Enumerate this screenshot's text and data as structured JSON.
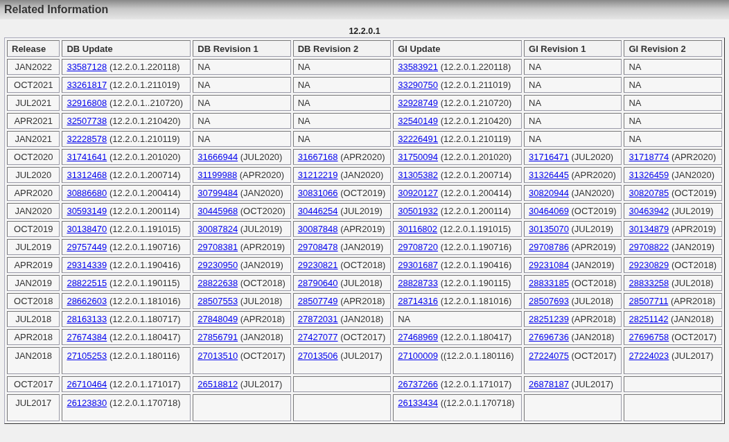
{
  "panel": {
    "title": "Related Information"
  },
  "table": {
    "caption": "12.2.0.1",
    "columns": [
      "Release",
      "DB Update",
      "DB Revision 1",
      "DB Revision 2",
      "GI Update",
      "GI Revision 1",
      "GI Revision 2"
    ],
    "rows": [
      {
        "cells": [
          {
            "kind": "text",
            "text": "JAN2022"
          },
          {
            "kind": "link",
            "link": "33587128",
            "note": "(12.2.0.1.220118)"
          },
          {
            "kind": "text",
            "text": "NA"
          },
          {
            "kind": "text",
            "text": "NA"
          },
          {
            "kind": "link",
            "link": "33583921",
            "note": "(12.2.0.1.220118)"
          },
          {
            "kind": "text",
            "text": "NA"
          },
          {
            "kind": "text",
            "text": "NA"
          }
        ]
      },
      {
        "cells": [
          {
            "kind": "text",
            "text": "OCT2021"
          },
          {
            "kind": "link",
            "link": "33261817",
            "note": "(12.2.0.1.211019)"
          },
          {
            "kind": "text",
            "text": "NA"
          },
          {
            "kind": "text",
            "text": "NA"
          },
          {
            "kind": "link",
            "link": "33290750",
            "note": "(12.2.0.1.211019)"
          },
          {
            "kind": "text",
            "text": "NA"
          },
          {
            "kind": "text",
            "text": "NA"
          }
        ]
      },
      {
        "cells": [
          {
            "kind": "text",
            "text": "JUL2021"
          },
          {
            "kind": "link",
            "link": "32916808",
            "note": "(12.2.0.1..210720)"
          },
          {
            "kind": "text",
            "text": "NA"
          },
          {
            "kind": "text",
            "text": "NA"
          },
          {
            "kind": "link",
            "link": "32928749",
            "note": "(12.2.0.1.210720)"
          },
          {
            "kind": "text",
            "text": "NA"
          },
          {
            "kind": "text",
            "text": "NA"
          }
        ]
      },
      {
        "cells": [
          {
            "kind": "text",
            "text": "APR2021"
          },
          {
            "kind": "link",
            "link": "32507738",
            "note": "(12.2.0.1.210420)"
          },
          {
            "kind": "text",
            "text": "NA"
          },
          {
            "kind": "text",
            "text": "NA"
          },
          {
            "kind": "link",
            "link": "32540149",
            "note": "(12.2.0.1.210420)"
          },
          {
            "kind": "text",
            "text": "NA"
          },
          {
            "kind": "text",
            "text": "NA"
          }
        ]
      },
      {
        "cells": [
          {
            "kind": "text",
            "text": "JAN2021"
          },
          {
            "kind": "link",
            "link": "32228578",
            "note": "(12.2.0.1.210119)"
          },
          {
            "kind": "text",
            "text": "NA"
          },
          {
            "kind": "text",
            "text": "NA"
          },
          {
            "kind": "link",
            "link": "32226491",
            "note": "(12.2.0.1.210119)"
          },
          {
            "kind": "text",
            "text": "NA"
          },
          {
            "kind": "text",
            "text": "NA"
          }
        ]
      },
      {
        "cells": [
          {
            "kind": "text",
            "text": "OCT2020"
          },
          {
            "kind": "link",
            "link": "31741641",
            "note": "(12.2.0.1.201020)"
          },
          {
            "kind": "link",
            "link": "31666944",
            "note": "(JUL2020)"
          },
          {
            "kind": "link",
            "link": "31667168",
            "note": "(APR2020)"
          },
          {
            "kind": "link",
            "link": "31750094",
            "note": "(12.2.0.1.201020)"
          },
          {
            "kind": "link",
            "link": "31716471",
            "note": "(JUL2020)"
          },
          {
            "kind": "link",
            "link": "31718774",
            "note": "(APR2020)"
          }
        ]
      },
      {
        "cells": [
          {
            "kind": "text",
            "text": "JUL2020"
          },
          {
            "kind": "link",
            "link": "31312468",
            "note": "(12.2.0.1.200714)"
          },
          {
            "kind": "link",
            "link": "31199988",
            "note": "(APR2020)"
          },
          {
            "kind": "link",
            "link": "31212219",
            "note": "(JAN2020)"
          },
          {
            "kind": "link",
            "link": "31305382",
            "note": "(12.2.0.1.200714)"
          },
          {
            "kind": "link",
            "link": "31326445",
            "note": "(APR2020)"
          },
          {
            "kind": "link",
            "link": "31326459",
            "note": "(JAN2020)"
          }
        ]
      },
      {
        "cells": [
          {
            "kind": "text",
            "text": "APR2020"
          },
          {
            "kind": "link",
            "link": "30886680",
            "note": "(12.2.0.1.200414)"
          },
          {
            "kind": "link",
            "link": "30799484",
            "note": "(JAN2020)"
          },
          {
            "kind": "link",
            "link": "30831066",
            "note": "(OCT2019)"
          },
          {
            "kind": "link",
            "link": "30920127",
            "note": "(12.2.0.1.200414)"
          },
          {
            "kind": "link",
            "link": "30820944",
            "note": "(JAN2020)"
          },
          {
            "kind": "link",
            "link": "30820785",
            "note": "(OCT2019)"
          }
        ]
      },
      {
        "cells": [
          {
            "kind": "text",
            "text": "JAN2020"
          },
          {
            "kind": "link",
            "link": "30593149",
            "note": "(12.2.0.1.200114)"
          },
          {
            "kind": "link",
            "link": "30445968",
            "note": "(OCT2020)"
          },
          {
            "kind": "link",
            "link": "30446254",
            "note": "(JUL2019)"
          },
          {
            "kind": "link",
            "link": "30501932",
            "note": "(12.2.0.1.200114)"
          },
          {
            "kind": "link",
            "link": "30464069",
            "note": "(OCT2019)"
          },
          {
            "kind": "link",
            "link": "30463942",
            "note": "(JUL2019)"
          }
        ]
      },
      {
        "cells": [
          {
            "kind": "text",
            "text": "OCT2019"
          },
          {
            "kind": "link",
            "link": "30138470",
            "note": "(12.2.0.1.191015)"
          },
          {
            "kind": "link",
            "link": "30087824",
            "note": "(JUL2019)"
          },
          {
            "kind": "link",
            "link": "30087848",
            "note": "(APR2019)"
          },
          {
            "kind": "link",
            "link": "30116802",
            "note": "(12.2.0.1.191015)"
          },
          {
            "kind": "link",
            "link": "30135070",
            "note": "(JUL2019)"
          },
          {
            "kind": "link",
            "link": "30134879",
            "note": "(APR2019)"
          }
        ]
      },
      {
        "cells": [
          {
            "kind": "text",
            "text": "JUL2019"
          },
          {
            "kind": "link",
            "link": "29757449",
            "note": "(12.2.0.1.190716)"
          },
          {
            "kind": "link",
            "link": "29708381",
            "note": "(APR2019)"
          },
          {
            "kind": "link",
            "link": "29708478",
            "note": "(JAN2019)"
          },
          {
            "kind": "link",
            "link": "29708720",
            "note": "(12.2.0.1.190716)"
          },
          {
            "kind": "link",
            "link": "29708786",
            "note": "(APR2019)"
          },
          {
            "kind": "link",
            "link": "29708822",
            "note": "(JAN2019)"
          }
        ]
      },
      {
        "cells": [
          {
            "kind": "text",
            "text": "APR2019"
          },
          {
            "kind": "link",
            "link": "29314339",
            "note": "(12.2.0.1.190416)"
          },
          {
            "kind": "link",
            "link": "29230950",
            "note": "(JAN2019)"
          },
          {
            "kind": "link",
            "link": "29230821",
            "note": "(OCT2018)"
          },
          {
            "kind": "link",
            "link": "29301687",
            "note": "(12.2.0.1.190416)"
          },
          {
            "kind": "link",
            "link": "29231084",
            "note": "(JAN2019)"
          },
          {
            "kind": "link",
            "link": "29230829",
            "note": "(OCT2018)"
          }
        ]
      },
      {
        "cells": [
          {
            "kind": "text",
            "text": "JAN2019"
          },
          {
            "kind": "link",
            "link": "28822515",
            "note": "(12.2.0.1.190115)"
          },
          {
            "kind": "link",
            "link": "28822638",
            "note": "(OCT2018)"
          },
          {
            "kind": "link",
            "link": "28790640",
            "note": "(JUL2018)"
          },
          {
            "kind": "link",
            "link": "28828733",
            "note": "(12.2.0.1.190115)"
          },
          {
            "kind": "link",
            "link": "28833185",
            "note": "(OCT2018)"
          },
          {
            "kind": "link",
            "link": "28833258",
            "note": "(JUL2018)"
          }
        ]
      },
      {
        "cells": [
          {
            "kind": "text",
            "text": "OCT2018"
          },
          {
            "kind": "link",
            "link": "28662603",
            "note": "(12.2.0.1.181016)"
          },
          {
            "kind": "link",
            "link": "28507553",
            "note": "(JUL2018)"
          },
          {
            "kind": "link",
            "link": "28507749",
            "note": "(APR2018)"
          },
          {
            "kind": "link",
            "link": "28714316",
            "note": "(12.2.0.1.181016)"
          },
          {
            "kind": "link",
            "link": "28507693",
            "note": "(JUL2018)"
          },
          {
            "kind": "link",
            "link": "28507711",
            "note": "(APR2018)"
          }
        ]
      },
      {
        "cells": [
          {
            "kind": "text",
            "text": "JUL2018"
          },
          {
            "kind": "link",
            "link": "28163133",
            "note": "(12.2.0.1.180717)"
          },
          {
            "kind": "link",
            "link": "27848049",
            "note": "(APR2018)"
          },
          {
            "kind": "link",
            "link": "27872031",
            "note": "(JAN2018)"
          },
          {
            "kind": "text",
            "text": "NA"
          },
          {
            "kind": "link",
            "link": "28251239",
            "note": "(APR2018)"
          },
          {
            "kind": "link",
            "link": "28251142",
            "note": "(JAN2018)"
          }
        ]
      },
      {
        "cells": [
          {
            "kind": "text",
            "text": "APR2018"
          },
          {
            "kind": "link",
            "link": "27674384",
            "note": "(12.2.0.1.180417)"
          },
          {
            "kind": "link",
            "link": "27856791",
            "note": "(JAN2018)"
          },
          {
            "kind": "link",
            "link": "27427077",
            "note": "(OCT2017)"
          },
          {
            "kind": "link",
            "link": "27468969",
            "note": "(12.2.0.1.180417)"
          },
          {
            "kind": "link",
            "link": "27696736",
            "note": "(JAN2018)"
          },
          {
            "kind": "link",
            "link": "27696758",
            "note": "(OCT2017)"
          }
        ]
      },
      {
        "cells": [
          {
            "kind": "text",
            "text": "JAN2018"
          },
          {
            "kind": "link",
            "link": "27105253",
            "note": "(12.2.0.1.180116)"
          },
          {
            "kind": "link",
            "link": "27013510",
            "note": "(OCT2017)"
          },
          {
            "kind": "link",
            "link": "27013506",
            "note": "(JUL2017)"
          },
          {
            "kind": "link",
            "link": "27100009",
            "note": "((12.2.0.1.180116)"
          },
          {
            "kind": "link",
            "link": "27224075",
            "note": "(OCT2017)"
          },
          {
            "kind": "link",
            "link": "27224023",
            "note": "(JUL2017)"
          }
        ]
      },
      {
        "cells": [
          {
            "kind": "text",
            "text": "OCT2017"
          },
          {
            "kind": "link",
            "link": "26710464",
            "note": "(12.2.0.1.171017)"
          },
          {
            "kind": "link",
            "link": "26518812",
            "note": "(JUL2017)"
          },
          {
            "kind": "empty"
          },
          {
            "kind": "link",
            "link": "26737266",
            "note": "(12.2.0.1.171017)"
          },
          {
            "kind": "link",
            "link": "26878187",
            "note": "(JUL2017)"
          },
          {
            "kind": "empty"
          }
        ]
      },
      {
        "cells": [
          {
            "kind": "text",
            "text": "JUL2017"
          },
          {
            "kind": "link",
            "link": "26123830",
            "note": "(12.2.0.1.170718)"
          },
          {
            "kind": "empty"
          },
          {
            "kind": "empty"
          },
          {
            "kind": "link",
            "link": "26133434",
            "note": "((12.2.0.1.170718)"
          },
          {
            "kind": "empty"
          },
          {
            "kind": "empty"
          }
        ]
      }
    ]
  }
}
